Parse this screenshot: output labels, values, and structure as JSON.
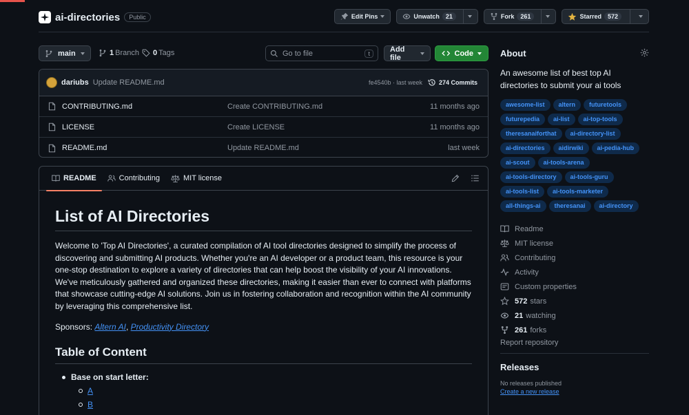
{
  "repo": {
    "name": "ai-directories",
    "visibility": "Public"
  },
  "header_actions": {
    "edit_pins": "Edit Pins",
    "watch": "Unwatch",
    "watch_count": "21",
    "fork": "Fork",
    "fork_count": "261",
    "star": "Starred",
    "star_count": "572"
  },
  "toolbar": {
    "branch": "main",
    "branch_count": "1",
    "branch_label": "Branch",
    "tag_count": "0",
    "tag_label": "Tags",
    "goto_placeholder": "Go to file",
    "goto_shortcut": "t",
    "add_file": "Add file",
    "code": "Code"
  },
  "latest_commit": {
    "author": "dariubs",
    "message": "Update README.md",
    "sha_time": "fe4540b · last week",
    "commits": "274 Commits"
  },
  "files": [
    {
      "name": "CONTRIBUTING.md",
      "commit": "Create CONTRIBUTING.md",
      "age": "11 months ago"
    },
    {
      "name": "LICENSE",
      "commit": "Create LICENSE",
      "age": "11 months ago"
    },
    {
      "name": "README.md",
      "commit": "Update README.md",
      "age": "last week"
    }
  ],
  "readme_tabs": {
    "readme": "README",
    "contributing": "Contributing",
    "license": "MIT license"
  },
  "readme": {
    "title": "List of AI Directories",
    "intro": "Welcome to 'Top AI Directories', a curated compilation of AI tool directories designed to simplify the process of discovering and submitting AI products. Whether you're an AI developer or a product team, this resource is your one-stop destination to explore a variety of directories that can help boost the visibility of your AI innovations. We've meticulously gathered and organized these directories, making it easier than ever to connect with platforms that showcase cutting-edge AI solutions. Join us in fostering collaboration and recognition within the AI community by leveraging this comprehensive list.",
    "sponsors_label": "Sponsors: ",
    "sponsor1": "Altern AI",
    "sponsor_sep": ", ",
    "sponsor2": "Productivity Directory",
    "toc_title": "Table of Content",
    "toc_item": "Base on start letter:",
    "toc_letters": [
      "A",
      "B"
    ]
  },
  "about": {
    "title": "About",
    "description": "An awesome list of best top AI directories to submit your ai tools",
    "topics": [
      "awesome-list",
      "altern",
      "futuretools",
      "futurepedia",
      "ai-list",
      "ai-top-tools",
      "theresanaiforthat",
      "ai-directory-list",
      "ai-directories",
      "aidirwiki",
      "ai-pedia-hub",
      "ai-scout",
      "ai-tools-arena",
      "ai-tools-directory",
      "ai-tools-guru",
      "ai-tools-list",
      "ai-tools-marketer",
      "all-things-ai",
      "theresanai",
      "ai-directory"
    ],
    "links": {
      "readme": "Readme",
      "license": "MIT license",
      "contributing": "Contributing",
      "activity": "Activity",
      "custom_properties": "Custom properties",
      "stars_count": "572",
      "stars_label": "stars",
      "watching_count": "21",
      "watching_label": "watching",
      "forks_count": "261",
      "forks_label": "forks",
      "report": "Report repository"
    }
  },
  "releases": {
    "title": "Releases",
    "none": "No releases published",
    "create": "Create a new release"
  }
}
